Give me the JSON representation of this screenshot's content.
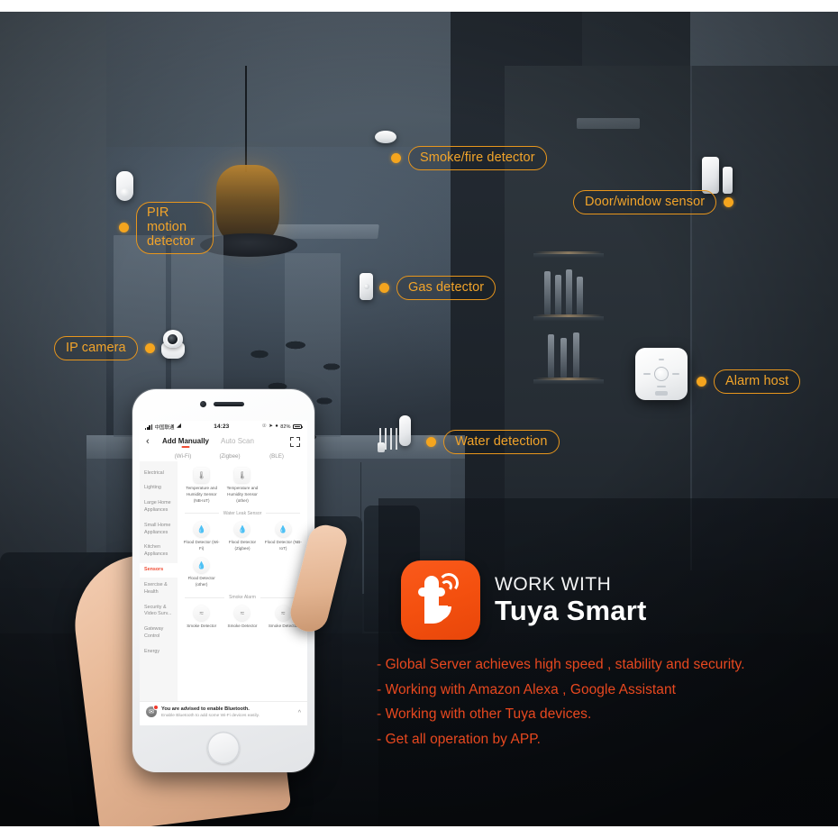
{
  "callouts": [
    {
      "id": "smoke-fire-detector",
      "label": "Smoke/fire detector"
    },
    {
      "id": "door-window-sensor",
      "label": "Door/window sensor"
    },
    {
      "id": "pir-motion-detector",
      "label": "PIR motion\ndetector"
    },
    {
      "id": "gas-detector",
      "label": "Gas detector"
    },
    {
      "id": "ip-camera",
      "label": "IP camera"
    },
    {
      "id": "alarm-host",
      "label": "Alarm host"
    },
    {
      "id": "water-detection",
      "label": "Water detection"
    }
  ],
  "phone": {
    "statusbar": {
      "carrier": "中国联通",
      "time": "14:23",
      "battery_pct": "82%",
      "wifi_icon": "wifi-icon",
      "signal_icon": "cellular-signal-icon",
      "battery_icon": "battery-icon",
      "alarm_icon": "alarm-icon",
      "location_icon": "location-arrow-icon",
      "mute_icon": "mute-bell-icon"
    },
    "nav": {
      "back_icon": "back-chevron-icon",
      "scan_icon": "scan-frame-icon",
      "tabs": [
        {
          "label": "Add Manually",
          "sub": "(Wi-Fi)",
          "active": true
        },
        {
          "label": "Auto Scan",
          "sub": "(Zigbee)",
          "active": false
        },
        {
          "label": "",
          "sub": "(BLE)",
          "active": false
        }
      ]
    },
    "sidebar": [
      {
        "label": "Electrical",
        "active": false
      },
      {
        "label": "Lighting",
        "active": false
      },
      {
        "label": "Large Home Appliances",
        "active": false
      },
      {
        "label": "Small Home Appliances",
        "active": false
      },
      {
        "label": "Kitchen Appliances",
        "active": false
      },
      {
        "label": "Sensors",
        "active": true
      },
      {
        "label": "Exercise & Health",
        "active": false
      },
      {
        "label": "Security & Video Surv...",
        "active": false
      },
      {
        "label": "Gateway Control",
        "active": false
      },
      {
        "label": "Energy",
        "active": false
      }
    ],
    "sections": [
      {
        "title": null,
        "devices": [
          {
            "label": "Temperature and Humidity Sensor (NB-IoT)",
            "icon": "thermometer-icon",
            "shape": "square"
          },
          {
            "label": "Temperature and Humidity Sensor (other)",
            "icon": "thermometer-icon",
            "shape": "square"
          }
        ]
      },
      {
        "title": "Water Leak Sensor",
        "devices": [
          {
            "label": "Flood Detector (Wi-Fi)",
            "icon": "water-drop-icon",
            "shape": "round"
          },
          {
            "label": "Flood Detector (Zigbee)",
            "icon": "water-drop-icon",
            "shape": "round"
          },
          {
            "label": "Flood Detector (NB-IoT)",
            "icon": "water-drop-icon",
            "shape": "round"
          },
          {
            "label": "Flood Detector (other)",
            "icon": "water-drop-icon",
            "shape": "round"
          }
        ]
      },
      {
        "title": "Smoke Alarm",
        "devices": [
          {
            "label": "Smoke Detector",
            "icon": "smoke-waves-icon",
            "shape": "round"
          },
          {
            "label": "Smoke Detector",
            "icon": "smoke-waves-icon",
            "shape": "round"
          },
          {
            "label": "Smoke Detector",
            "icon": "smoke-waves-icon",
            "shape": "round"
          }
        ]
      }
    ],
    "bluetooth_notice": {
      "icon": "bluetooth-icon",
      "badge": "1",
      "title": "You are advised to enable Bluetooth.",
      "subtitle": "Enable Bluetooth to add some Wi-Fi devices easily.",
      "collapse_icon": "chevron-up-icon"
    }
  },
  "brand": {
    "logo_icon": "tuya-t-wifi-logo",
    "line1": "WORK WITH",
    "line2": "Tuya Smart"
  },
  "bullets": [
    "- Global Server achieves high speed , stability and security.",
    "- Working with Amazon Alexa , Google Assistant",
    "- Working with other Tuya devices.",
    "- Get all operation by APP."
  ],
  "colors": {
    "callout_orange": "#f2a42a",
    "callout_border": "#e8961c",
    "dot_orange": "#f5a51e",
    "brand_orange": "#f4500f",
    "bullet_red": "#e8481f",
    "app_accent": "#f04e36"
  }
}
